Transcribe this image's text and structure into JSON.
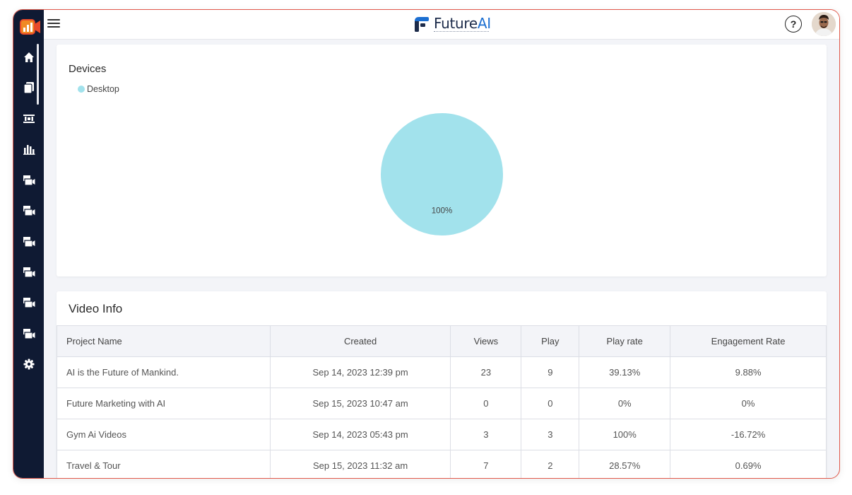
{
  "app": {
    "logo_text_main": "Future",
    "logo_text_accent": "AI",
    "help_label": "?"
  },
  "sidebar": {
    "items": [
      {
        "icon": "home-icon"
      },
      {
        "icon": "pages-icon"
      },
      {
        "icon": "film-strip-icon"
      },
      {
        "icon": "bar-chart-icon"
      },
      {
        "icon": "video-camera-icon"
      },
      {
        "icon": "video-camera-icon"
      },
      {
        "icon": "video-camera-icon"
      },
      {
        "icon": "video-camera-icon"
      },
      {
        "icon": "video-camera-icon"
      },
      {
        "icon": "video-camera-icon"
      },
      {
        "icon": "gear-icon"
      }
    ]
  },
  "devices": {
    "title": "Devices",
    "legend": [
      {
        "label": "Desktop",
        "color": "#a2e2ec"
      }
    ],
    "pie_label": "100%"
  },
  "chart_data": {
    "type": "pie",
    "title": "Devices",
    "slices": [
      {
        "label": "Desktop",
        "value": 100,
        "color": "#a2e2ec"
      }
    ],
    "legend_position": "top-left"
  },
  "video_info": {
    "title": "Video Info",
    "columns": [
      "Project Name",
      "Created",
      "Views",
      "Play",
      "Play rate",
      "Engagement Rate"
    ],
    "rows": [
      [
        "AI is the Future of Mankind.",
        "Sep 14, 2023 12:39 pm",
        "23",
        "9",
        "39.13%",
        "9.88%"
      ],
      [
        "Future Marketing with AI",
        "Sep 15, 2023 10:47 am",
        "0",
        "0",
        "0%",
        "0%"
      ],
      [
        "Gym Ai Videos",
        "Sep 14, 2023 05:43 pm",
        "3",
        "3",
        "100%",
        "-16.72%"
      ],
      [
        "Travel & Tour",
        "Sep 15, 2023 11:32 am",
        "7",
        "2",
        "28.57%",
        "0.69%"
      ]
    ]
  }
}
